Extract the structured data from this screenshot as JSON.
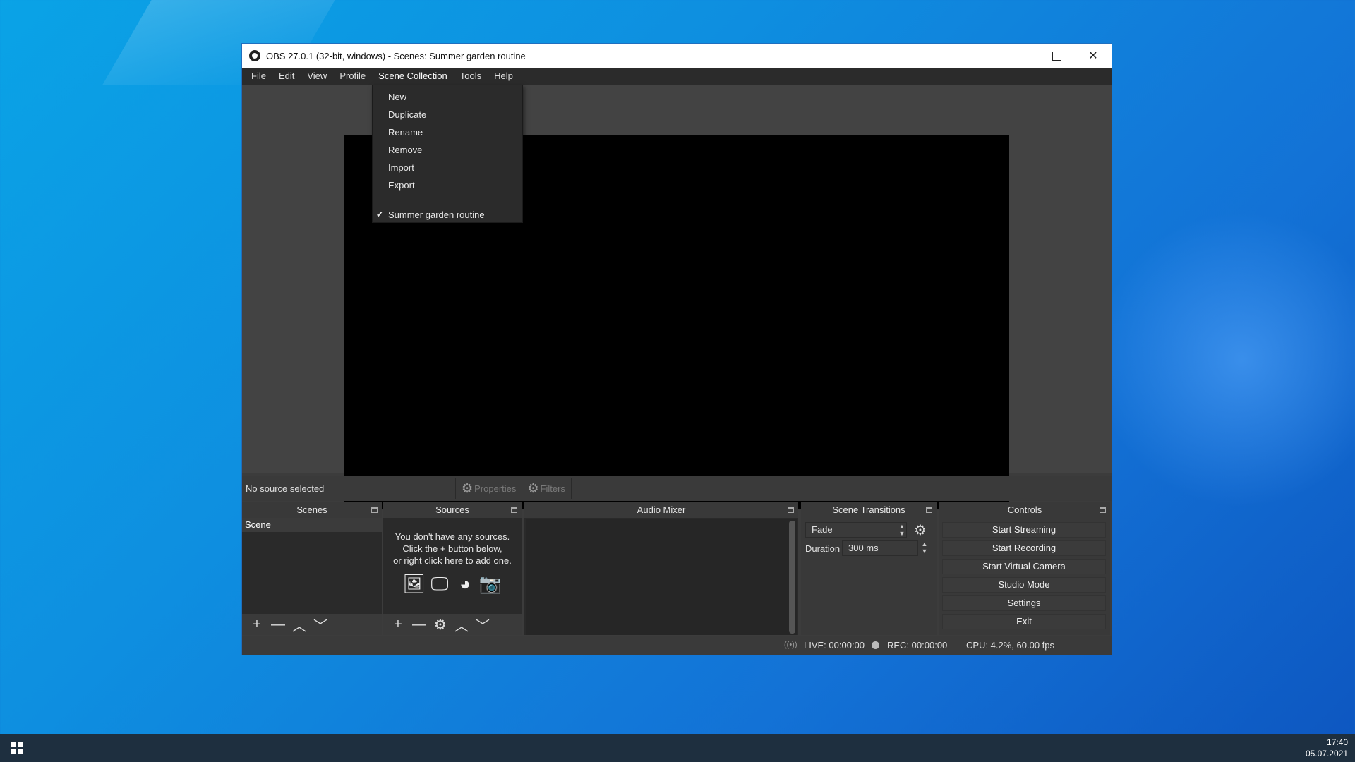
{
  "window": {
    "title": "OBS 27.0.1 (32-bit, windows) -  Scenes: Summer garden routine",
    "close_glyph": "✕"
  },
  "menubar": {
    "items": [
      "File",
      "Edit",
      "View",
      "Profile",
      "Scene Collection",
      "Tools",
      "Help"
    ]
  },
  "dropdown": {
    "items": [
      "New",
      "Duplicate",
      "Rename",
      "Remove",
      "Import",
      "Export"
    ],
    "collection": "Summer garden routine",
    "check_glyph": "✔"
  },
  "source_toolbar": {
    "no_source": "No source selected",
    "properties": "Properties",
    "filters": "Filters"
  },
  "scenes": {
    "title": "Scenes",
    "items": [
      "Scene"
    ]
  },
  "sources": {
    "title": "Sources",
    "empty_line1": "You don't have any sources.",
    "empty_line2": "Click the + button below,",
    "empty_line3": "or right click here to add one."
  },
  "audio_mixer": {
    "title": "Audio Mixer"
  },
  "transitions": {
    "title": "Scene Transitions",
    "selected": "Fade",
    "duration_label": "Duration",
    "duration_value": "300 ms"
  },
  "controls": {
    "title": "Controls",
    "start_streaming": "Start Streaming",
    "start_recording": "Start Recording",
    "start_virtual_camera": "Start Virtual Camera",
    "studio_mode": "Studio Mode",
    "settings": "Settings",
    "exit": "Exit"
  },
  "status": {
    "live": "LIVE: 00:00:00",
    "rec": "REC: 00:00:00",
    "cpu": "CPU: 4.2%, 60.00 fps"
  },
  "taskbar": {
    "time": "17:40",
    "date": "05.07.2021"
  },
  "icons": {
    "plus": "+",
    "minus": "—",
    "up": "︿",
    "down": "﹀",
    "gear": "⚙",
    "spin_up": "▲",
    "spin_down": "▼",
    "broadcast": "((•))",
    "image": "🖼",
    "display": "🖵",
    "globe": "◕",
    "camera": "📷"
  }
}
